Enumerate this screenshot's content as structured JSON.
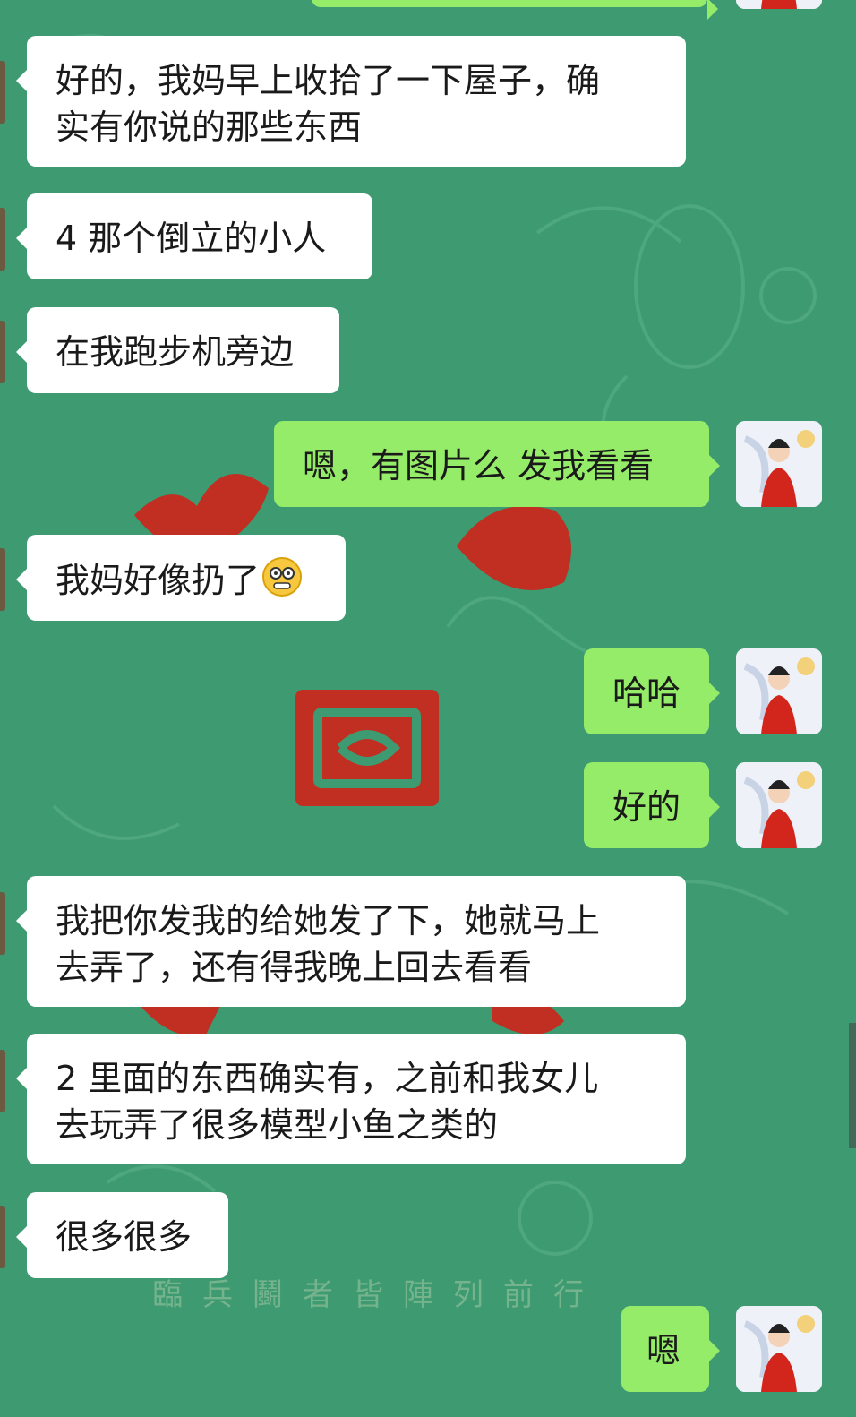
{
  "chat": {
    "messages": [
      {
        "from": "them",
        "text": "好的，我妈早上收拾了一下屋子，确\n实有你说的那些东西"
      },
      {
        "from": "them",
        "text": "4 那个倒立的小人"
      },
      {
        "from": "them",
        "text": "在我跑步机旁边"
      },
      {
        "from": "me",
        "text": "嗯，有图片么 发我看看"
      },
      {
        "from": "them",
        "text": "我妈好像扔了",
        "emoji": "grimace-emoji"
      },
      {
        "from": "me",
        "text": "哈哈"
      },
      {
        "from": "me",
        "text": "好的"
      },
      {
        "from": "them",
        "text": "我把你发我的给她发了下，她就马上\n去弄了，还有得我晚上回去看看"
      },
      {
        "from": "them",
        "text": "2 里面的东西确实有，之前和我女儿\n去玩弄了很多模型小鱼之类的"
      },
      {
        "from": "them",
        "text": "很多很多"
      },
      {
        "from": "me",
        "text": "嗯"
      }
    ]
  },
  "background": {
    "watermark_text": "臨兵鬬者皆陣列前行",
    "base_color": "#3d9a71",
    "accent_color": "#c8281e"
  },
  "colors": {
    "incoming_bubble": "#ffffff",
    "outgoing_bubble": "#95ec69"
  },
  "icons": {
    "avatar": "woman-in-red-avatar",
    "emoji": "grimace-emoji"
  }
}
